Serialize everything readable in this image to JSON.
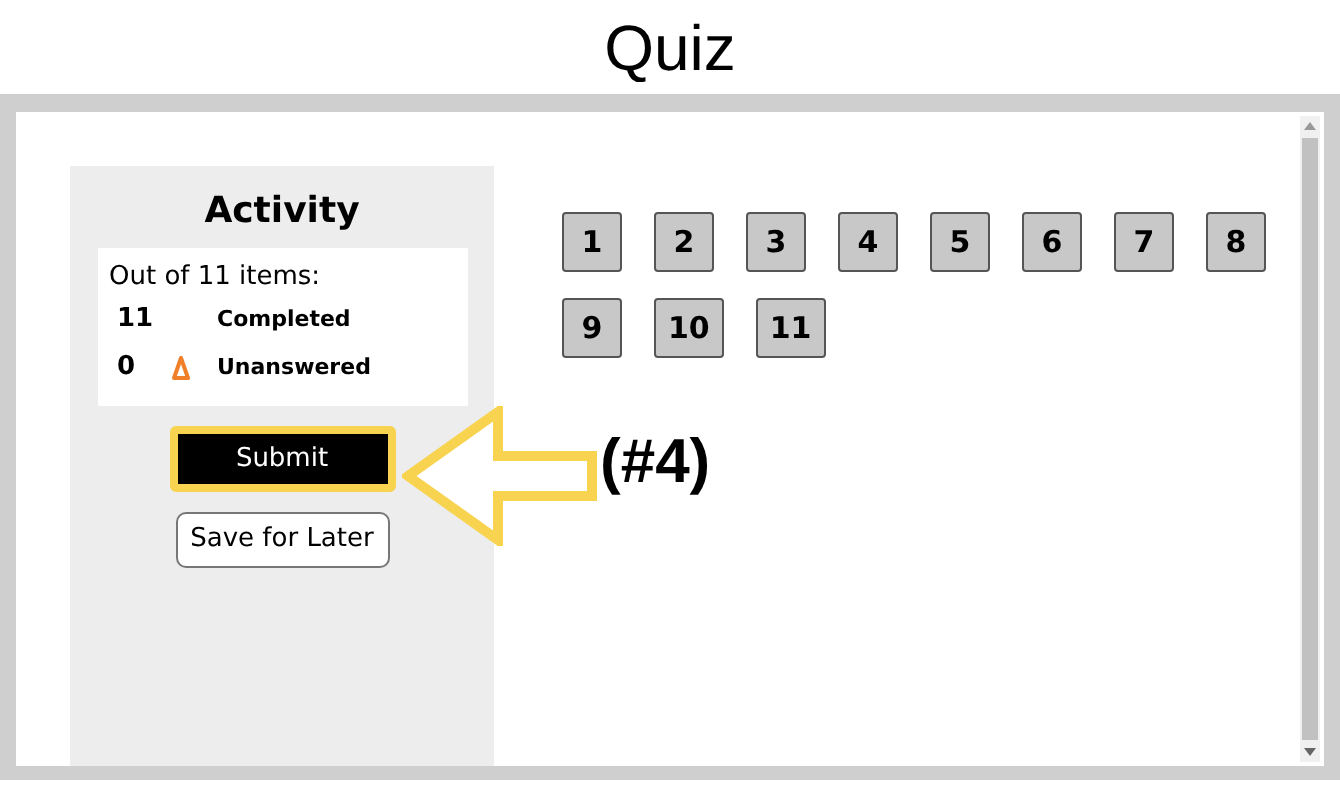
{
  "slide_title": "Quiz",
  "annotation": {
    "label": "(#4)"
  },
  "activity": {
    "heading": "Activity",
    "summary": "Out of 11 items:",
    "stats": [
      {
        "count": "11",
        "label": "Completed",
        "kind": "plain"
      },
      {
        "count": "0",
        "label": "Unanswered",
        "kind": "warning"
      }
    ],
    "buttons": [
      {
        "label": "Submit",
        "kind": "primary",
        "highlighted": true
      },
      {
        "label": "Save for Later",
        "kind": "secondary",
        "highlighted": false
      }
    ]
  },
  "questions": [
    "1",
    "2",
    "3",
    "4",
    "5",
    "6",
    "7",
    "8",
    "9",
    "10",
    "11"
  ]
}
